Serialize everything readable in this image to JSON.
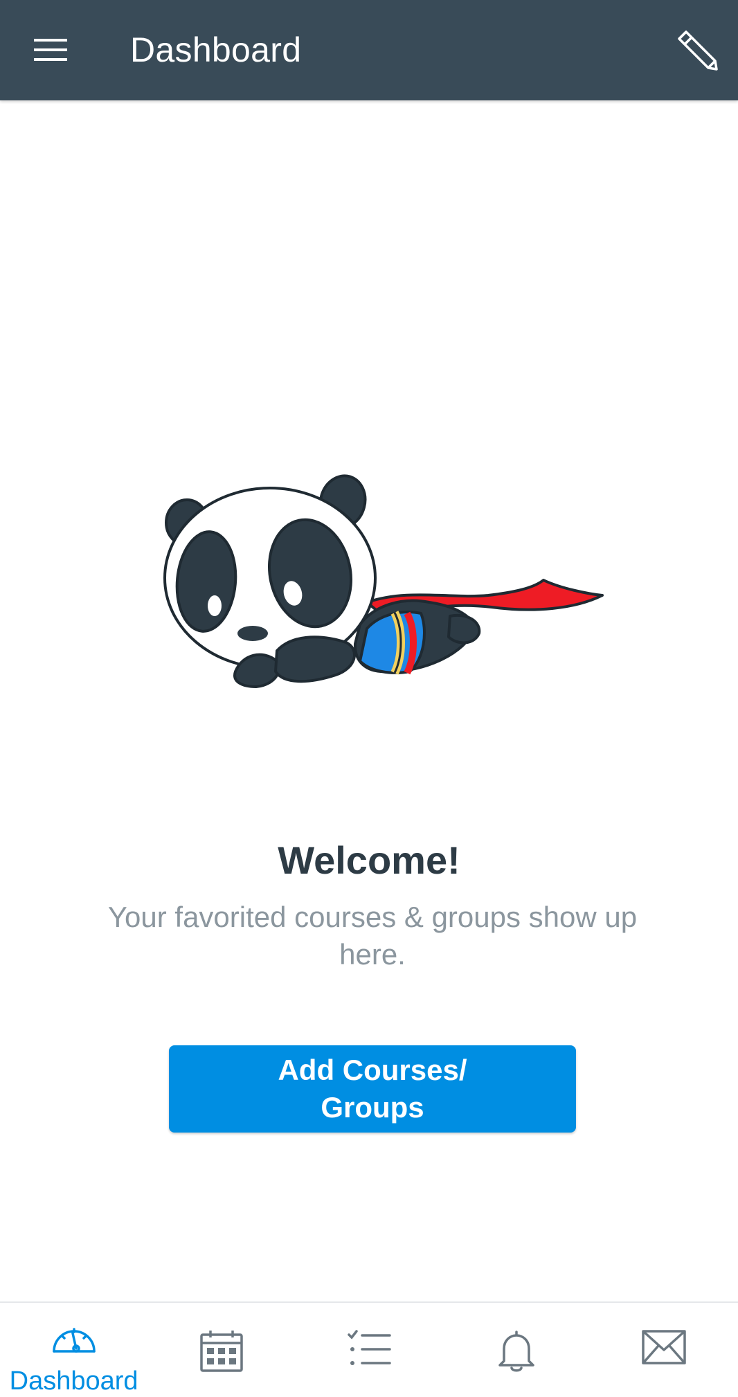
{
  "header": {
    "title": "Dashboard",
    "menu_icon": "hamburger-menu-icon",
    "edit_icon": "pencil-icon",
    "background": "#394b58"
  },
  "main": {
    "illustration": "flying-panda-superhero",
    "welcome": "Welcome!",
    "subtitle": "Your favorited courses & groups show up here.",
    "add_button_label": "Add Courses/ Groups"
  },
  "bottom_nav": {
    "active_color": "#008ee2",
    "inactive_color": "#6b7780",
    "tabs": [
      {
        "label": "Dashboard",
        "icon": "dashboard-gauge-icon",
        "active": true
      },
      {
        "icon": "calendar-icon",
        "active": false
      },
      {
        "icon": "todo-list-icon",
        "active": false
      },
      {
        "icon": "bell-icon",
        "active": false
      },
      {
        "icon": "mail-icon",
        "active": false
      }
    ]
  }
}
